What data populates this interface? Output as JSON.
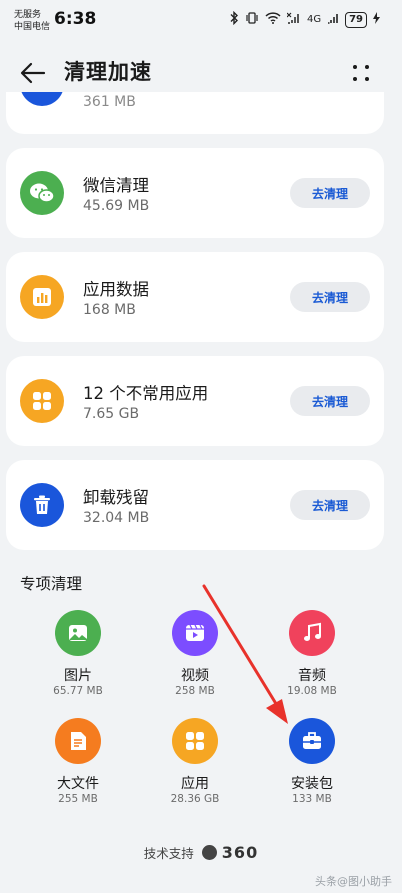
{
  "status_bar": {
    "carrier_line1": "无服务",
    "carrier_line2": "中国电信",
    "time": "6:38",
    "network": "4G",
    "battery": "79"
  },
  "app_bar": {
    "title": "清理加速"
  },
  "partial_card": {
    "size": "361 MB"
  },
  "cards": [
    {
      "name": "微信清理",
      "size": "45.69 MB",
      "button": "去清理",
      "icon": "wechat-icon",
      "color": "#4caf50"
    },
    {
      "name": "应用数据",
      "size": "168 MB",
      "button": "去清理",
      "icon": "bar-chart-icon",
      "color": "#f6a623"
    },
    {
      "name": "12 个不常用应用",
      "size": "7.65 GB",
      "button": "去清理",
      "icon": "apps-grid-icon",
      "color": "#f6a623"
    },
    {
      "name": "卸载残留",
      "size": "32.04 MB",
      "button": "去清理",
      "icon": "trash-icon",
      "color": "#1a56db"
    }
  ],
  "special": {
    "title": "专项清理",
    "items": [
      {
        "name": "图片",
        "size": "65.77 MB",
        "icon": "image-icon",
        "color": "#4caf50"
      },
      {
        "name": "视频",
        "size": "258 MB",
        "icon": "video-icon",
        "color": "#7c4dff"
      },
      {
        "name": "音频",
        "size": "19.08 MB",
        "icon": "music-icon",
        "color": "#f0425c"
      },
      {
        "name": "大文件",
        "size": "255 MB",
        "icon": "document-icon",
        "color": "#f57c1f"
      },
      {
        "name": "应用",
        "size": "28.36 GB",
        "icon": "apps-grid-icon",
        "color": "#f6a623"
      },
      {
        "name": "安装包",
        "size": "133 MB",
        "icon": "package-icon",
        "color": "#1a56db"
      }
    ]
  },
  "footer": {
    "label": "技术支持",
    "brand": "360"
  },
  "watermark": "头条@图小助手",
  "colors": {
    "accent": "#1a5ad4",
    "annotation_arrow": "#e8322b"
  }
}
